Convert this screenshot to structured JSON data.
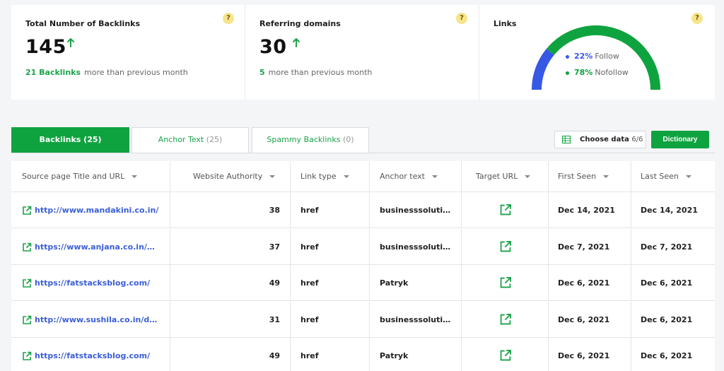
{
  "cards": {
    "backlinks": {
      "title": "Total Number of Backlinks",
      "value": "145",
      "sub_highlight": "21 Backlinks",
      "sub_text": "more than previous month",
      "help": "?"
    },
    "domains": {
      "title": "Referring domains",
      "value": "30",
      "sub_highlight": "5",
      "sub_text": "more than previous month",
      "help": "?"
    },
    "links": {
      "title": "Links",
      "help": "?",
      "follow_pct": "22%",
      "follow_label": "Follow",
      "nofollow_pct": "78%",
      "nofollow_label": "Nofollow",
      "follow_fraction": 0.22
    }
  },
  "colors": {
    "green": "#0fa33f",
    "blue": "#3758e6",
    "link": "#3a5fd8",
    "help_bg": "#f8e48a"
  },
  "tabs": [
    {
      "label": "Backlinks (25)",
      "count": "",
      "active": true
    },
    {
      "label": "Anchor Text",
      "count": "(25)",
      "active": false
    },
    {
      "label": "Spammy Backlinks",
      "count": "(0)",
      "active": false
    }
  ],
  "toolbar": {
    "choose_label": "Choose data",
    "choose_count": "6/6",
    "dictionary_label": "Dictionary"
  },
  "table": {
    "headers": [
      "Source page Title and URL",
      "Website Authority",
      "Link type",
      "Anchor text",
      "Target URL",
      "First Seen",
      "Last Seen"
    ],
    "rows": [
      {
        "url": "http://www.mandakini.co.in/",
        "authority": "38",
        "type": "href",
        "anchor": "businesssolutionhub",
        "first": "Dec 14, 2021",
        "last": "Dec 14, 2021"
      },
      {
        "url": "https://www.anjana.co.in/diy-ideas/",
        "authority": "37",
        "type": "href",
        "anchor": "businesssolutionhub",
        "first": "Dec 7, 2021",
        "last": "Dec 7, 2021"
      },
      {
        "url": "https://fatstacksblog.com/",
        "authority": "49",
        "type": "href",
        "anchor": "Patryk",
        "first": "Dec 6, 2021",
        "last": "Dec 6, 2021"
      },
      {
        "url": "http://www.sushila.co.in/domain/",
        "authority": "31",
        "type": "href",
        "anchor": "businesssolutionhub",
        "first": "Dec 6, 2021",
        "last": "Dec 6, 2021"
      },
      {
        "url": "https://fatstacksblog.com/",
        "authority": "49",
        "type": "href",
        "anchor": "Patryk",
        "first": "Dec 6, 2021",
        "last": "Dec 6, 2021"
      }
    ]
  },
  "icons": {
    "up": "arrow-up-icon",
    "help": "question-icon",
    "external": "external-link-icon",
    "columns": "table-columns-icon",
    "sort": "caret-down-icon"
  }
}
